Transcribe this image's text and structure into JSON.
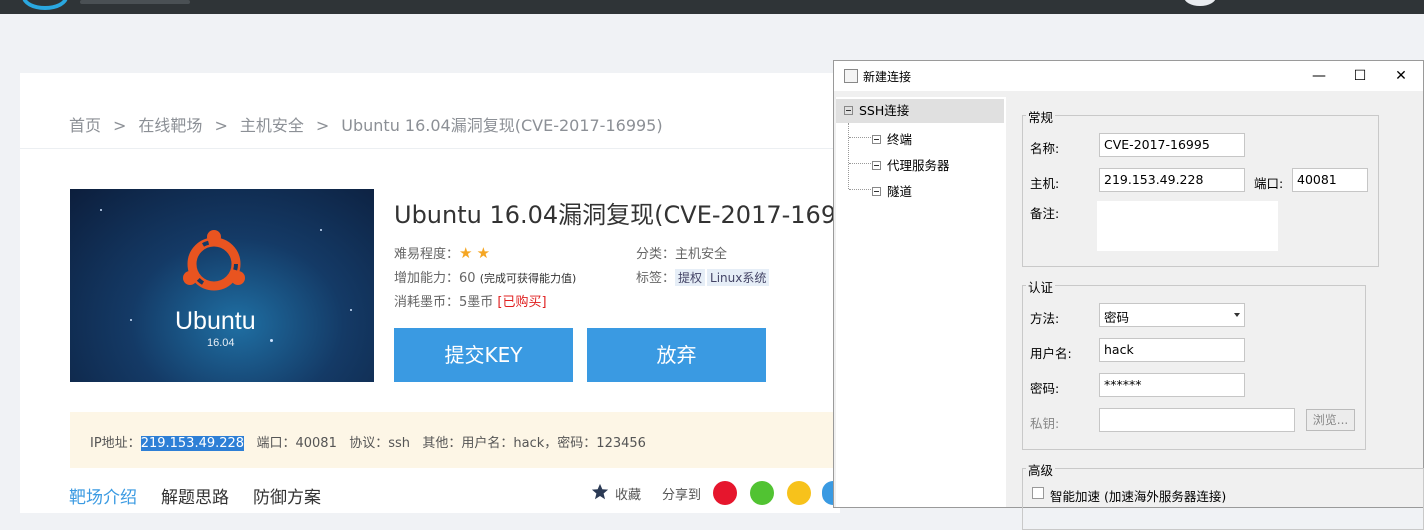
{
  "breadcrumb": [
    "首页",
    "在线靶场",
    "主机安全",
    "Ubuntu 16.04漏洞复现(CVE-2017-16995)"
  ],
  "breadcrumb_sep": ">",
  "cover": {
    "word": "Ubuntu",
    "version": "16.04"
  },
  "lab": {
    "title": "Ubuntu 16.04漏洞复现(CVE-2017-1699",
    "difficulty_label": "难易程度：",
    "difficulty_stars": 2,
    "ability_label": "增加能力：60",
    "ability_note": "(完成可获得能力值)",
    "cost_label": "消耗墨币：5墨币",
    "cost_status": "[已购买]",
    "category": "分类：主机安全",
    "tags_label": "标签：",
    "tags": [
      "提权",
      "Linux系统"
    ],
    "submit_label": "提交KEY",
    "abandon_label": "放弃"
  },
  "info": {
    "ip_label": "IP地址：",
    "ip_value": "219.153.49.228",
    "rest": "端口：40081   协议：ssh   其他：用户名：hack，密码：123456"
  },
  "tabs": [
    "靶场介绍",
    "解题思路",
    "防御方案"
  ],
  "share": {
    "collect_label": "收藏",
    "share_label": "分享到"
  },
  "colors": {
    "accent": "#3a9ae2",
    "highlight": "#2d7fd6",
    "danger": "#e02020",
    "star": "#f5a623"
  },
  "dialog": {
    "title": "新建连接",
    "window_buttons": [
      "—",
      "☐",
      "✕"
    ],
    "tree": {
      "root": "SSH连接",
      "children": [
        "终端",
        "代理服务器",
        "隧道"
      ]
    },
    "general": {
      "legend": "常规",
      "name_label": "名称:",
      "name_value": "CVE-2017-16995",
      "host_label": "主机:",
      "host_value": "219.153.49.228",
      "port_label": "端口:",
      "port_value": "40081",
      "note_label": "备注:"
    },
    "auth": {
      "legend": "认证",
      "method_label": "方法:",
      "method_value": "密码",
      "user_label": "用户名:",
      "user_value": "hack",
      "pass_label": "密码:",
      "pass_value": "******",
      "key_label": "私钥:",
      "browse_label": "浏览..."
    },
    "advanced": {
      "legend": "高级",
      "accel_label": "智能加速 (加速海外服务器连接)"
    }
  }
}
